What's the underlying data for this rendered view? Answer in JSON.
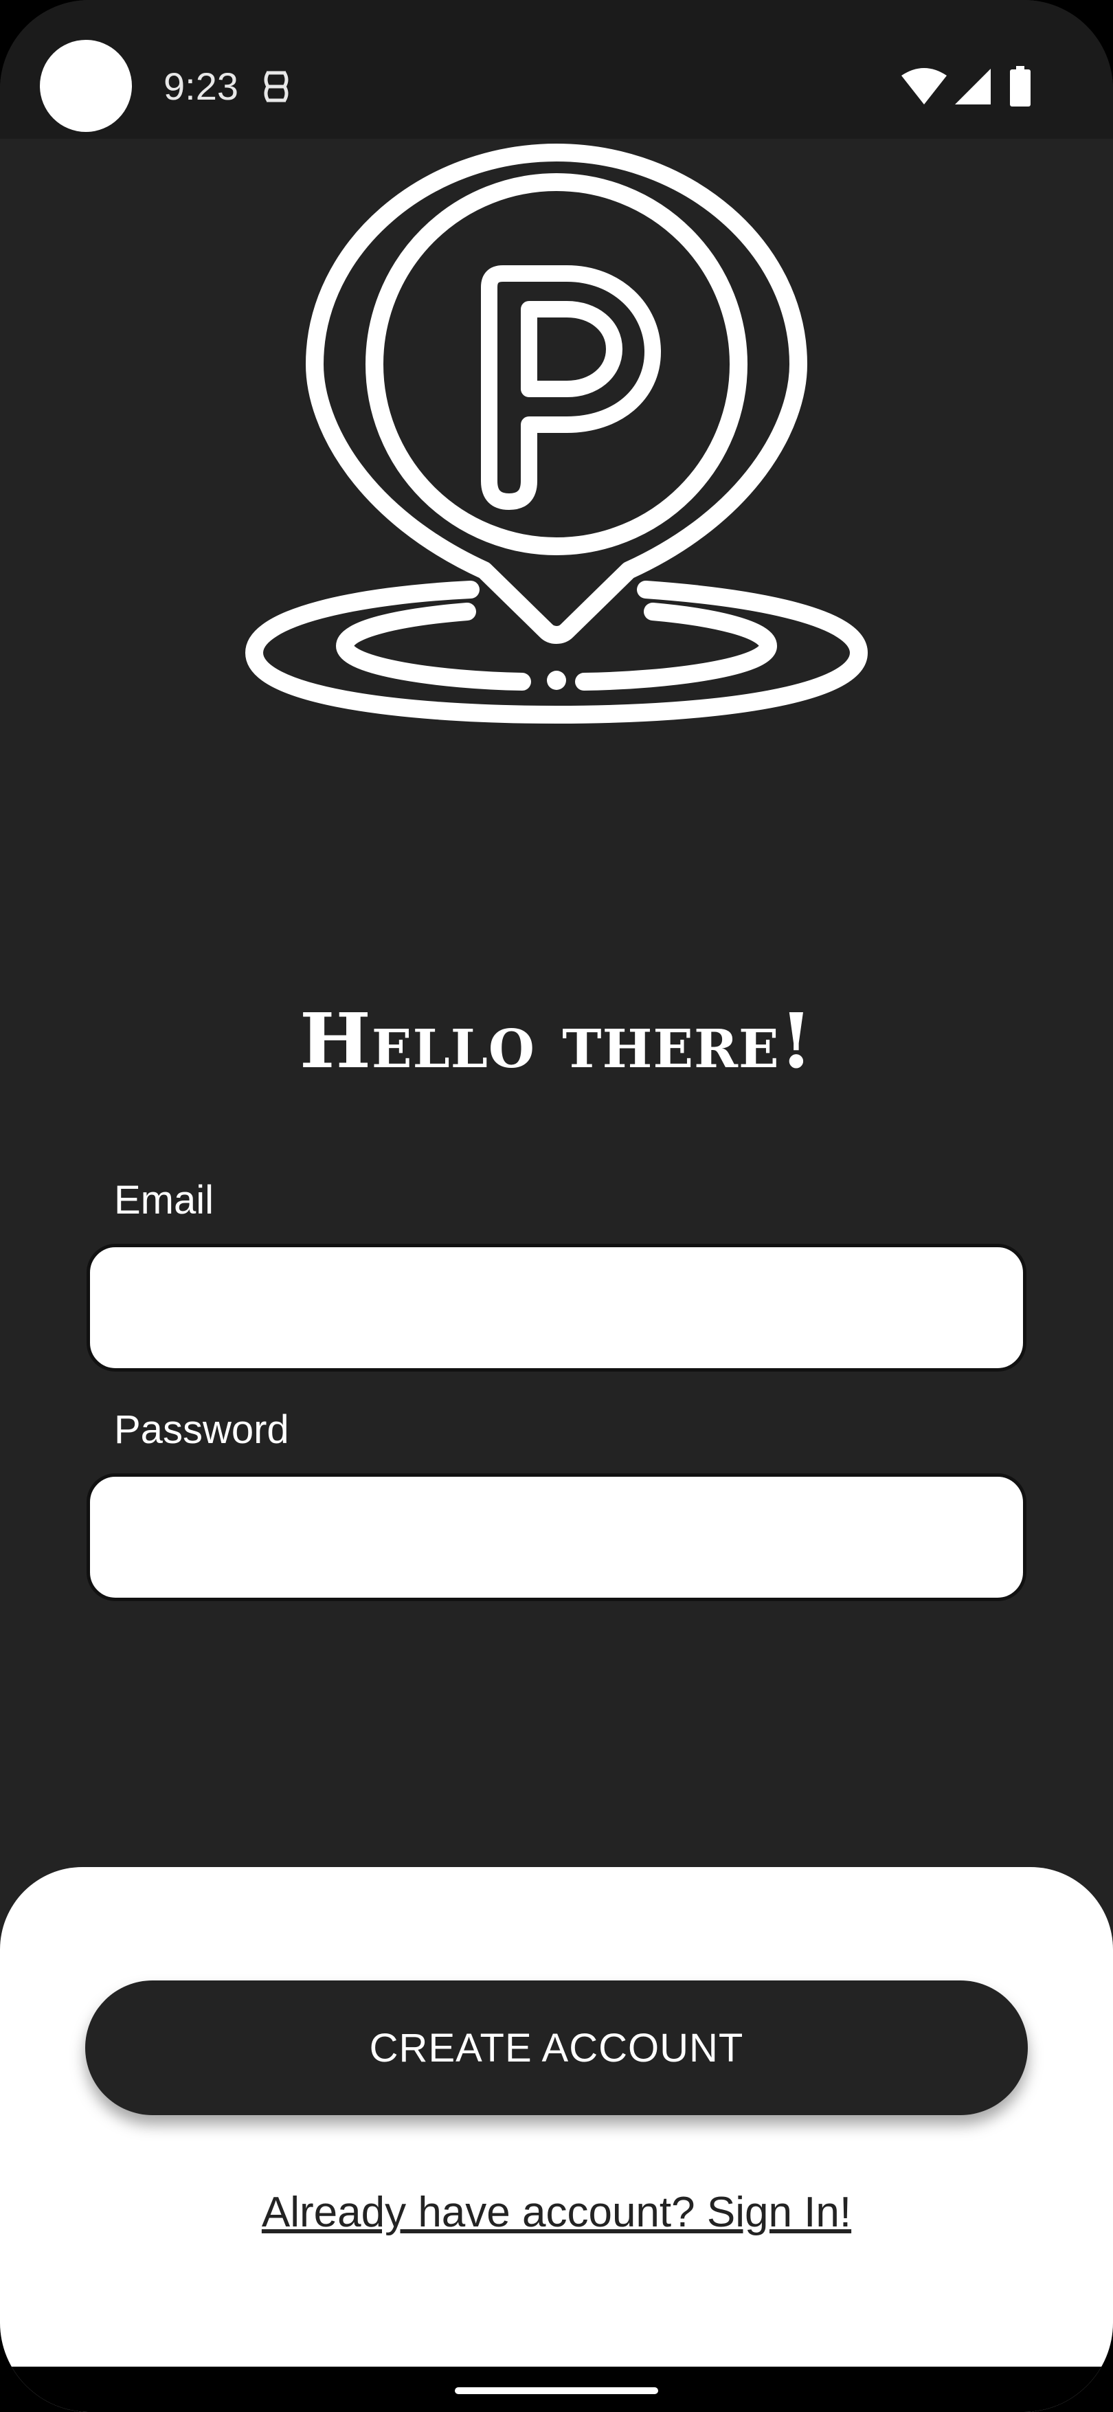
{
  "status_bar": {
    "time": "9:23",
    "icons": [
      "notification-icon",
      "wifi-icon",
      "cellular-signal-icon",
      "battery-icon"
    ]
  },
  "logo": {
    "icon": "parking-location-pin-icon",
    "letter": "P"
  },
  "title": "Hello there!",
  "form": {
    "email_label": "Email",
    "email_value": "",
    "password_label": "Password",
    "password_value": ""
  },
  "actions": {
    "create_account_label": "CREATE ACCOUNT",
    "signin_link_label": "Already have account? Sign In!"
  },
  "colors": {
    "background": "#232323",
    "status_bar": "#1b1b1b",
    "sheet": "#ffffff",
    "button": "#232323",
    "text_light": "#ffffff"
  }
}
